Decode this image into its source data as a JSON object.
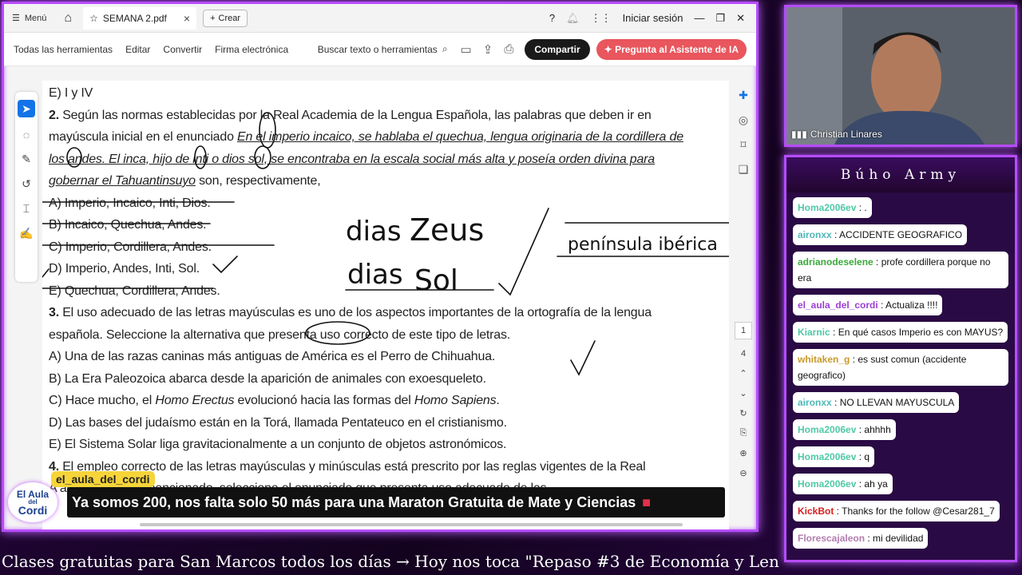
{
  "pdf": {
    "menu_label": "Menú",
    "tab_title": "SEMANA 2.pdf",
    "create_label": "Crear",
    "signin_label": "Iniciar sesión",
    "toolbar": {
      "all_tools": "Todas las herramientas",
      "edit": "Editar",
      "convert": "Convertir",
      "esign": "Firma electrónica",
      "search_placeholder": "Buscar texto o herramientas",
      "share": "Compartir",
      "ai_assistant": "Pregunta al Asistente de IA"
    },
    "page_nav": {
      "current": "1",
      "total": "4"
    },
    "doc_lines": {
      "l0": "E) I y IV",
      "q2_num": "2.",
      "q2_a": " Según las normas establecidas por la Real Academia de la Lengua Española, las palabras que deben ir en",
      "q2_b": "mayúscula inicial en el enunciado ",
      "q2_b_i": "En el imperio incaico, se hablaba el quechua, lengua originaria de la cordillera de",
      "q2_c_i": "los andes. El inca, hijo de inti o dios sol, se encontraba en la escala social más alta y poseía orden divina para",
      "q2_d_i": "gobernar el Tahuantinsuyo",
      "q2_d": " son, respectivamente,",
      "q2_A": "A) Imperio, Incaico, Inti, Dios.",
      "q2_B": "B) Incaico, Quechua, Andes.",
      "q2_C": "C) Imperio, Cordillera, Andes.",
      "q2_D": "D) Imperio, Andes, Inti, Sol.",
      "q2_E": "E) Quechua, Cordillera, Andes.",
      "q3_num": "3.",
      "q3_a": " El uso adecuado de las letras mayúsculas es uno de los aspectos importantes de la ortografía de la lengua",
      "q3_b": "española. Seleccione la alternativa que presenta uso correcto de este tipo de letras.",
      "q3_A": "A) Una de las razas caninas más antiguas de América es el Perro de Chihuahua.",
      "q3_B": "B) La Era Paleozoica abarca desde la aparición de animales con exoesqueleto.",
      "q3_C1": "C) Hace mucho, el ",
      "q3_C2": "Homo Erectus",
      "q3_C3": " evolucionó hacia las formas del ",
      "q3_C4": "Homo Sapiens",
      "q3_C5": ".",
      "q3_D": "D) Las bases del judaísmo están en la Torá, llamada Pentateuco en el cristianismo.",
      "q3_E": "E) El Sistema Solar liga gravitacionalmente a un conjunto de objetos astronómicos.",
      "q4_num": "4.",
      "q4_a": " El empleo correcto de las letras mayúsculas y minúsculas está prescrito por las reglas vigentes de la Real",
      "q4_b": "A   acuerdo con lo mencionado, seleccione el enunciado que presenta uso adecuado de las"
    },
    "ink_text": {
      "w1": "dias",
      "w2": "Zeus",
      "w3": "dias",
      "w4": "Sol",
      "w5": "península ibérica"
    }
  },
  "cam": {
    "name": "Christian Linares"
  },
  "chat": {
    "title": "Búho Army",
    "messages": [
      {
        "user": "Homa2006ev",
        "text": " : .",
        "color": "#4fc9a6"
      },
      {
        "user": "aironxx",
        "text": " : ACCIDENTE GEOGRAFICO",
        "color": "#4fb7b8"
      },
      {
        "user": "adrianodeselene",
        "text": " : profe cordillera porque no era",
        "color": "#3aa93a"
      },
      {
        "user": "el_aula_del_cordi",
        "text": " : Actualiza !!!!",
        "color": "#9b3fd2"
      },
      {
        "user": "Kiarnic",
        "text": " : En qué casos Imperio es con MAYUS?",
        "color": "#4fc9a6"
      },
      {
        "user": "whitaken_g",
        "text": " : es sust comun (accidente geografico)",
        "color": "#c89a2b"
      },
      {
        "user": "aironxx",
        "text": " : NO LLEVAN MAYUSCULA",
        "color": "#4fb7b8"
      },
      {
        "user": "Homa2006ev",
        "text": " : ahhhh",
        "color": "#4fc9a6"
      },
      {
        "user": "Homa2006ev",
        "text": " : q",
        "color": "#4fc9a6"
      },
      {
        "user": "Homa2006ev",
        "text": " : ah ya",
        "color": "#4fc9a6"
      },
      {
        "user": "KickBot",
        "text": " : Thanks for the follow @Cesar281_7",
        "color": "#d81e1e"
      },
      {
        "user": "Florescajaleon",
        "text": " : mi devilidad",
        "color": "#b47cb0"
      }
    ]
  },
  "overlay": {
    "logo_l1": "El Aula",
    "logo_l2": "del",
    "logo_l3": "Cordi",
    "user_tag": "el_aula_del_cordi",
    "announce": "Ya somos 200, nos falta solo 50 más para una Maraton Gratuita de Mate y Ciencias",
    "ticker": "Clases gratuitas para San Marcos todos los días  →  Hoy nos toca \"Repaso #3 de Economía y Len"
  },
  "colors": {
    "frame": "#b64cff",
    "share_bg": "#1a1a1a",
    "ai_bg": "#e9565d",
    "tag_bg": "#f6d43a"
  }
}
